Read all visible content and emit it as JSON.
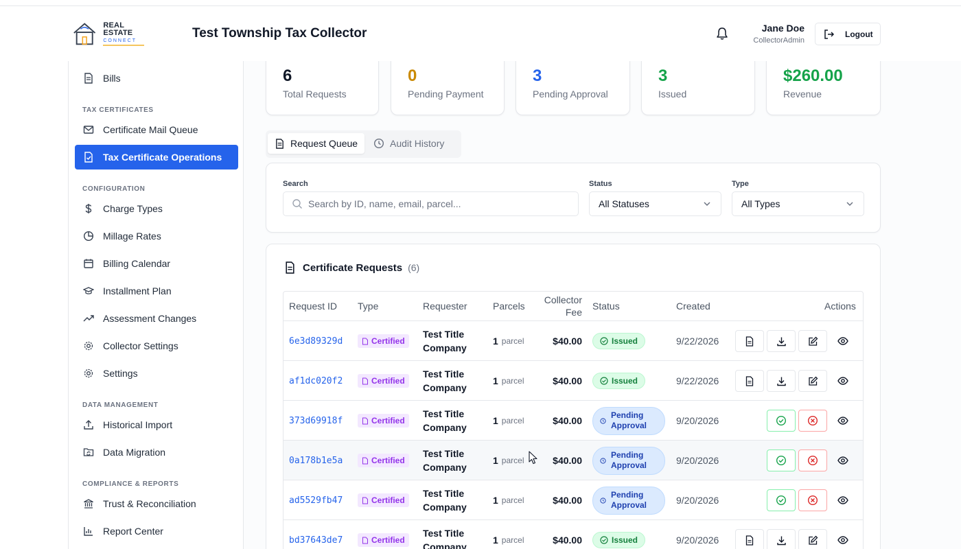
{
  "header": {
    "logo": {
      "line1": "REAL ESTATE",
      "line2": "CONNECT"
    },
    "title": "Test Township Tax Collector",
    "user_name": "Jane Doe",
    "user_role": "CollectorAdmin",
    "logout_label": "Logout"
  },
  "sidebar": {
    "bills": "Bills",
    "sec_tax": "TAX CERTIFICATES",
    "mail_queue": "Certificate Mail Queue",
    "operations": "Tax Certificate Operations",
    "sec_config": "CONFIGURATION",
    "charge_types": "Charge Types",
    "millage_rates": "Millage Rates",
    "billing_calendar": "Billing Calendar",
    "installment_plan": "Installment Plan",
    "assessment_changes": "Assessment Changes",
    "collector_settings": "Collector Settings",
    "settings": "Settings",
    "sec_data": "DATA MANAGEMENT",
    "historical_import": "Historical Import",
    "data_migration": "Data Migration",
    "sec_compliance": "COMPLIANCE & REPORTS",
    "trust": "Trust & Reconciliation",
    "report_center": "Report Center"
  },
  "stats": [
    {
      "value": "6",
      "label": "Total Requests",
      "color": "#111827"
    },
    {
      "value": "0",
      "label": "Pending Payment",
      "color": "#ca8a04"
    },
    {
      "value": "3",
      "label": "Pending Approval",
      "color": "#2563eb"
    },
    {
      "value": "3",
      "label": "Issued",
      "color": "#16a34a"
    },
    {
      "value": "$260.00",
      "label": "Revenue",
      "color": "#16a34a"
    }
  ],
  "tabs": {
    "queue": "Request Queue",
    "audit": "Audit History"
  },
  "filters": {
    "search_label": "Search",
    "search_placeholder": "Search by ID, name, email, parcel...",
    "status_label": "Status",
    "status_value": "All Statuses",
    "type_label": "Type",
    "type_value": "All Types"
  },
  "requests": {
    "title": "Certificate Requests",
    "count": "(6)",
    "columns": {
      "id": "Request ID",
      "type": "Type",
      "requester": "Requester",
      "parcels": "Parcels",
      "fee_line1": "Collector",
      "fee_line2": "Fee",
      "status": "Status",
      "created": "Created",
      "actions": "Actions"
    },
    "rows": [
      {
        "id": "6e3d89329d",
        "type": "Certified",
        "requester": "Test Title Company",
        "parcels": "1",
        "parcel_unit": "parcel",
        "fee": "$40.00",
        "status": "Issued",
        "created": "9/22/2026"
      },
      {
        "id": "af1dc020f2",
        "type": "Certified",
        "requester": "Test Title Company",
        "parcels": "1",
        "parcel_unit": "parcel",
        "fee": "$40.00",
        "status": "Issued",
        "created": "9/22/2026"
      },
      {
        "id": "373d69918f",
        "type": "Certified",
        "requester": "Test Title Company",
        "parcels": "1",
        "parcel_unit": "parcel",
        "fee": "$40.00",
        "status": "Pending Approval",
        "created": "9/20/2026"
      },
      {
        "id": "0a178b1e5a",
        "type": "Certified",
        "requester": "Test Title Company",
        "parcels": "1",
        "parcel_unit": "parcel",
        "fee": "$40.00",
        "status": "Pending Approval",
        "created": "9/20/2026"
      },
      {
        "id": "ad5529fb47",
        "type": "Certified",
        "requester": "Test Title Company",
        "parcels": "1",
        "parcel_unit": "parcel",
        "fee": "$40.00",
        "status": "Pending Approval",
        "created": "9/20/2026"
      },
      {
        "id": "bd37643de7",
        "type": "Certified",
        "requester": "Test Title Company",
        "parcels": "1",
        "parcel_unit": "parcel",
        "fee": "$40.00",
        "status": "Issued",
        "created": "9/20/2026"
      }
    ]
  }
}
